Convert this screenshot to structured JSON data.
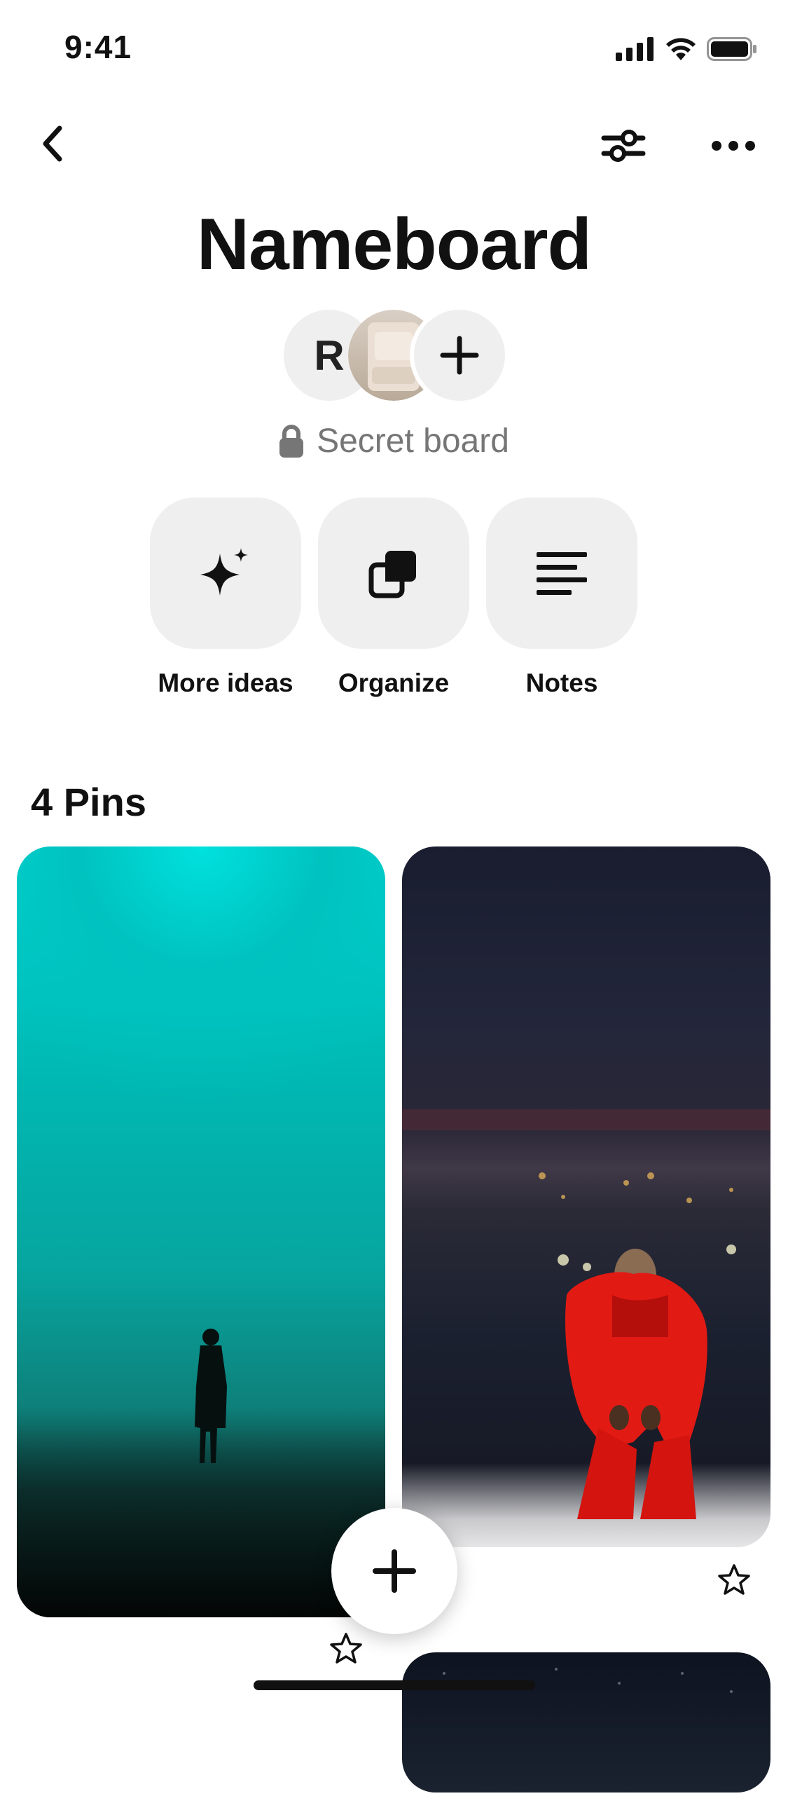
{
  "status_bar": {
    "time": "9:41"
  },
  "icons": {
    "back": "chevron-left-icon",
    "filter": "sliders-icon",
    "more": "ellipsis-icon",
    "secret": "lock-icon",
    "more_ideas": "sparkle-icon",
    "organize": "stack-icon",
    "notes": "notes-lines-icon",
    "favorite": "star-icon",
    "create": "plus-icon"
  },
  "board": {
    "title": "Nameboard",
    "collaborator_initial": "R",
    "privacy": "Secret board",
    "pins_count": "4 Pins"
  },
  "actions": [
    {
      "label": "More ideas"
    },
    {
      "label": "Organize"
    },
    {
      "label": "Notes"
    }
  ],
  "colors": {
    "accent_teal": "#00d6d2",
    "tile_bg": "#efefef",
    "muted_text": "#767676"
  }
}
